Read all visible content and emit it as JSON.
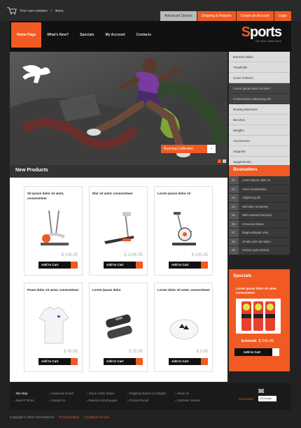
{
  "cart": {
    "prefix": "Your cart contains",
    "count": "0",
    "suffix": "items"
  },
  "toplinks": [
    {
      "label": "Advanced Search"
    },
    {
      "label": "Shipping & Returns"
    },
    {
      "label": "Create an Account"
    },
    {
      "label": "Login"
    }
  ],
  "nav": [
    {
      "label": "Home Page"
    },
    {
      "label": "What's New?"
    },
    {
      "label": "Specials"
    },
    {
      "label": "My Account"
    },
    {
      "label": "Contacts"
    }
  ],
  "logo": {
    "s": "S",
    "rest": "ports",
    "tagline": "The best online store"
  },
  "hero": {
    "button_label": "Running Collection"
  },
  "categories": [
    "Exercise Bikes",
    "Treadmills",
    "Cross Trainers",
    "Lorem ipsum dolor sit amet",
    "Consectetuer adipiscing elit",
    "Rowing Machines",
    "Benches",
    "Weights",
    "Accessories",
    "Supports",
    "Supplements"
  ],
  "new_products": {
    "title": "New Products",
    "add_label": "Add to Cart",
    "items": [
      {
        "name": "Sit ipsum dolor sit amet, consectetuer",
        "price": "$ 245.95"
      },
      {
        "name": "Dlor sit amet, consectetuer",
        "price": "$ 2245.95"
      },
      {
        "name": "Lorem ipsum dolor sit",
        "price": "$ 245.95"
      },
      {
        "name": "Psum dolor sit amet, consectetuer",
        "price": "$ 45.95"
      },
      {
        "name": "Lorem ipsum dolor",
        "price": "$ 25.95"
      },
      {
        "name": "Lorem dolor sit amet, consectetuer",
        "price": "$ 5.95"
      }
    ]
  },
  "bestsellers": {
    "title": "Bestsellers",
    "items": [
      {
        "n": "01.",
        "label": "Lorem ipsum dolor sit"
      },
      {
        "n": "02.",
        "label": "Amet consectetuer"
      },
      {
        "n": "03.",
        "label": "Adipiscing elit"
      },
      {
        "n": "04.",
        "label": "Sed diam nonummy"
      },
      {
        "n": "05.",
        "label": "Nibh euismod tincidunt"
      },
      {
        "n": "06.",
        "label": "Ut laoreet dolore"
      },
      {
        "n": "07.",
        "label": "Magna aliquam erat"
      },
      {
        "n": "08.",
        "label": "Ut wisi enim ad minim"
      },
      {
        "n": "09.",
        "label": "Veniam quis nostrud"
      }
    ]
  },
  "specials": {
    "title": "Specials",
    "name": "Lorem ipsum dolor sit amet, consectetuer",
    "old_price": "$ 245.95",
    "new_price": "$ 245.95",
    "add_label": "Add to Cart"
  },
  "footer": {
    "col1": [
      "Site Map",
      "Search Terms"
    ],
    "col2": [
      "Advanced Search",
      "Contact Us"
    ],
    "col3": [
      "Check Order Status",
      "Returns & Exchanges"
    ],
    "col4": [
      "Shipping Options & Charges",
      "Product Recall"
    ],
    "col5": [
      "About Us",
      "Customer Service"
    ],
    "currency_label": "Currencies:",
    "currency_value": "US Dollar"
  },
  "copyright": {
    "text": "Copyright © 2010 osCommerce",
    "privacy": "Privacy Notice",
    "conditions": "Conditions of Use"
  },
  "colors": {
    "accent": "#f15a22",
    "dark": "#111111"
  }
}
